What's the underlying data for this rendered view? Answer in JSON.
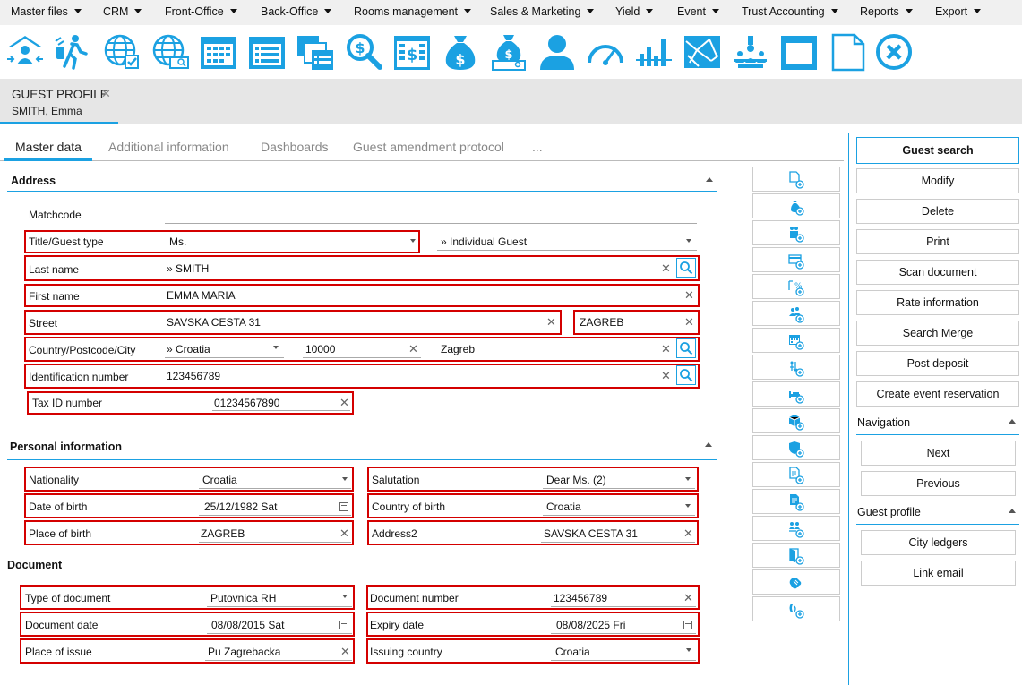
{
  "menu": [
    {
      "label": "Master files"
    },
    {
      "label": "CRM"
    },
    {
      "label": "Front-Office"
    },
    {
      "label": "Back-Office"
    },
    {
      "label": "Rooms management"
    },
    {
      "label": "Sales & Marketing"
    },
    {
      "label": "Yield"
    },
    {
      "label": "Event"
    },
    {
      "label": "Trust Accounting"
    },
    {
      "label": "Reports"
    },
    {
      "label": "Export"
    }
  ],
  "toolbar_icons": [
    "guest-checkin-icon",
    "departure-icon",
    "globe-check-icon",
    "globe-search-icon",
    "calendar-grid-icon",
    "list-view-icon",
    "stacked-documents-icon",
    "search-money-icon",
    "invoice-icon",
    "money-bag-icon",
    "money-bag-search-icon",
    "user-icon",
    "gauge-icon",
    "bar-chart-icon",
    "map-icon",
    "meeting-icon",
    "floor-plan-icon",
    "blank-page-icon",
    "close-circle-icon"
  ],
  "accent_color": "#1ba1e2",
  "highlight_color": "#d40000",
  "profile_tab": {
    "title": "GUEST PROFILE",
    "close": "✕",
    "subtitle": "SMITH, Emma"
  },
  "tabs": [
    {
      "label": "Master data"
    },
    {
      "label": "Additional information"
    },
    {
      "label": "Dashboards"
    },
    {
      "label": "Guest amendment protocol"
    },
    {
      "label": "..."
    }
  ],
  "address": {
    "title": "Address",
    "matchcode": {
      "label": "Matchcode",
      "value": ""
    },
    "title_type": {
      "label": "Title/Guest type",
      "value": "Ms.",
      "guest_type": "» Individual Guest"
    },
    "last_name": {
      "label": "Last name",
      "value": "» SMITH"
    },
    "first_name": {
      "label": "First name",
      "value": "EMMA MARIA"
    },
    "street": {
      "label": "Street",
      "value": "SAVSKA CESTA 31",
      "extra": "ZAGREB"
    },
    "country": {
      "label": "Country/Postcode/City",
      "country": "» Croatia",
      "postcode": "10000",
      "city": "Zagreb"
    },
    "id_number": {
      "label": "Identification number",
      "value": "123456789"
    },
    "tax_id": {
      "label": "Tax ID number",
      "value": "01234567890"
    }
  },
  "personal": {
    "title": "Personal information",
    "nationality": {
      "label": "Nationality",
      "value": "Croatia"
    },
    "salutation": {
      "label": "Salutation",
      "value": "Dear Ms. (2)"
    },
    "dob": {
      "label": "Date of birth",
      "value": "25/12/1982 Sat"
    },
    "country_of_birth": {
      "label": "Country of birth",
      "value": "Croatia"
    },
    "place_of_birth": {
      "label": "Place of birth",
      "value": "ZAGREB"
    },
    "address2": {
      "label": "Address2",
      "value": "SAVSKA CESTA 31"
    }
  },
  "document": {
    "title": "Document",
    "type": {
      "label": "Type of document",
      "value": "Putovnica RH"
    },
    "number": {
      "label": "Document number",
      "value": "123456789"
    },
    "date": {
      "label": "Document date",
      "value": "08/08/2015 Sat"
    },
    "expiry": {
      "label": "Expiry date",
      "value": "08/08/2025 Fri"
    },
    "place": {
      "label": "Place of issue",
      "value": "Pu Zagrebacka"
    },
    "country": {
      "label": "Issuing country",
      "value": "Croatia"
    }
  },
  "side_icons": [
    "document-add-icon",
    "money-bag-add-icon",
    "people-add-icon",
    "card-add-icon",
    "calendar-percent-add-icon",
    "group-add-icon",
    "calendar-add-icon",
    "person-sort-add-icon",
    "bed-add-icon",
    "package-add-icon",
    "shield-add-icon",
    "document-list-add-icon",
    "invoice-add-icon",
    "people-transfer-add-icon",
    "door-add-icon",
    "handshake-icon",
    "phone-add-icon"
  ],
  "actions": {
    "guest_search": "Guest search",
    "modify": "Modify",
    "delete": "Delete",
    "print": "Print",
    "scan": "Scan document",
    "rate": "Rate information",
    "search_merge": "Search  Merge",
    "post_deposit": "Post deposit",
    "event": "Create event reservation"
  },
  "navigation": {
    "title": "Navigation",
    "next": "Next",
    "previous": "Previous"
  },
  "guest_profile_panel": {
    "title": "Guest profile",
    "city_ledgers": "City ledgers",
    "link_email": "Link email"
  }
}
